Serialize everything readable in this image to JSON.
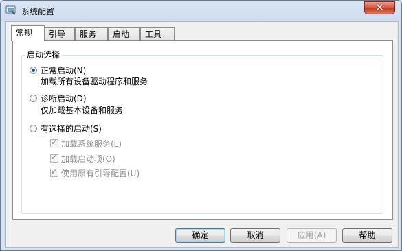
{
  "window": {
    "title": "系统配置",
    "close_glyph": "✕",
    "icon": "msconfig-icon"
  },
  "tabs": [
    {
      "label": "常规",
      "active": true
    },
    {
      "label": "引导",
      "active": false
    },
    {
      "label": "服务",
      "active": false
    },
    {
      "label": "启动",
      "active": false
    },
    {
      "label": "工具",
      "active": false
    }
  ],
  "startup_group": {
    "label": "启动选择",
    "options": [
      {
        "label": "正常启动(N)",
        "description": "加载所有设备驱动程序和服务",
        "selected": true
      },
      {
        "label": "诊断启动(D)",
        "description": "仅加载基本设备和服务",
        "selected": false
      },
      {
        "label": "有选择的启动(S)",
        "selected": false
      }
    ],
    "selective_items": [
      {
        "label": "加载系统服务(L)",
        "checked": true,
        "enabled": false
      },
      {
        "label": "加载启动项(O)",
        "checked": true,
        "enabled": false
      },
      {
        "label": "使用原有引导配置(U)",
        "checked": true,
        "enabled": false
      }
    ]
  },
  "buttons": {
    "ok": "确定",
    "cancel": "取消",
    "apply": "应用(A)",
    "help": "帮助"
  },
  "colors": {
    "accent": "#3c7fb1",
    "close_button": "#c23a1e"
  }
}
